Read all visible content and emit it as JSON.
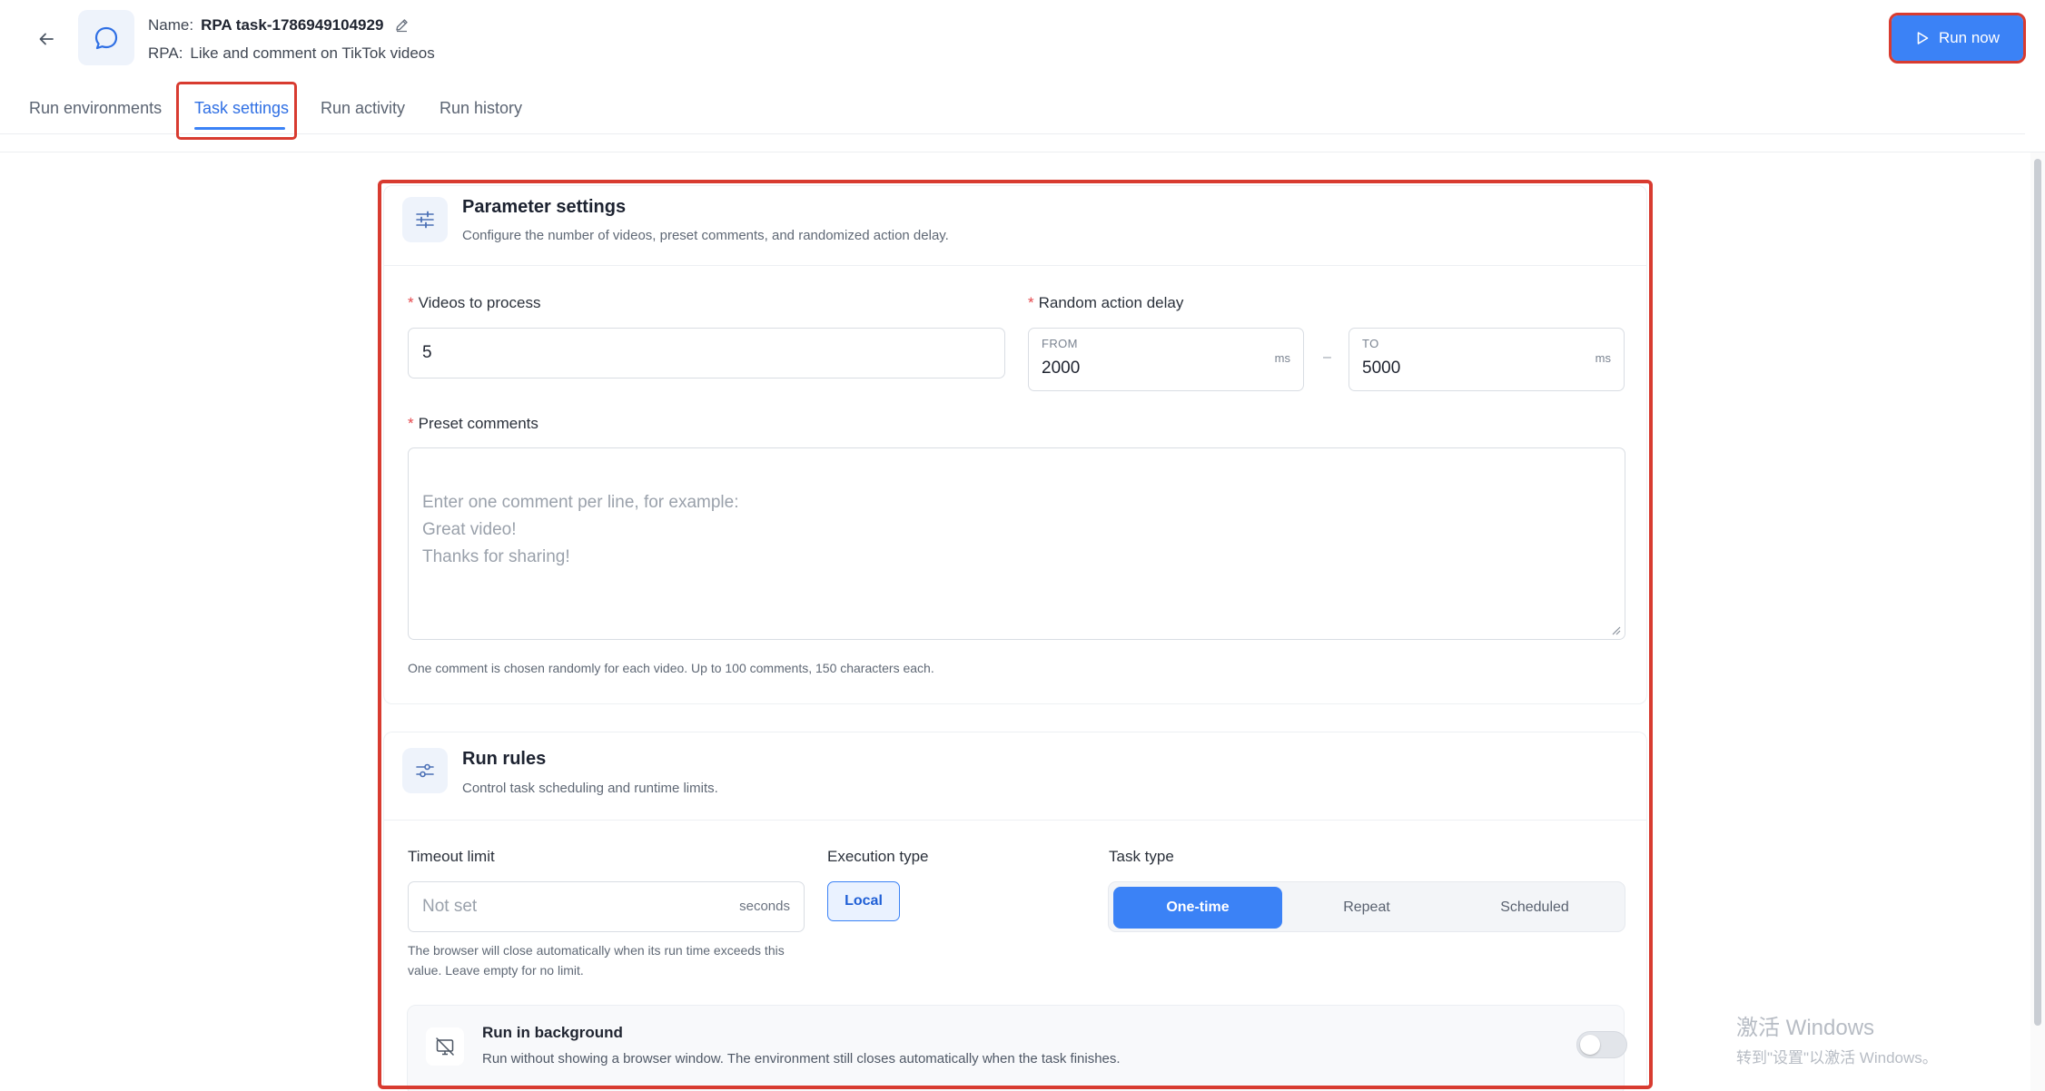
{
  "header": {
    "name_key": "Name:",
    "name_value": "RPA task-1786949104929",
    "rpa_key": "RPA:",
    "rpa_value": "Like and comment on TikTok videos",
    "run_now_label": "Run now"
  },
  "tabs": [
    {
      "label": "Run environments",
      "active": false
    },
    {
      "label": "Task settings",
      "active": true
    },
    {
      "label": "Run activity",
      "active": false
    },
    {
      "label": "Run history",
      "active": false
    }
  ],
  "parameter_settings": {
    "title": "Parameter settings",
    "subtitle": "Configure the number of videos, preset comments, and randomized action delay.",
    "videos_label": "Videos to process",
    "videos_value": "5",
    "delay_label": "Random action delay",
    "delay_from_caption": "FROM",
    "delay_from_value": "2000",
    "delay_to_caption": "TO",
    "delay_to_value": "5000",
    "delay_unit": "ms",
    "delay_separator": "–",
    "comments_label": "Preset comments",
    "comments_placeholder": "Enter one comment per line, for example:\nGreat video!\nThanks for sharing!",
    "comments_help": "One comment is chosen randomly for each video. Up to 100 comments, 150 characters each."
  },
  "run_rules": {
    "title": "Run rules",
    "subtitle": "Control task scheduling and runtime limits.",
    "timeout_label": "Timeout limit",
    "timeout_placeholder": "Not set",
    "timeout_unit": "seconds",
    "timeout_help": "The browser will close automatically when its run time exceeds this value. Leave empty for no limit.",
    "execution_label": "Execution type",
    "execution_value": "Local",
    "task_type_label": "Task type",
    "task_type_options": [
      "One-time",
      "Repeat",
      "Scheduled"
    ],
    "task_type_selected": "One-time",
    "background_title": "Run in background",
    "background_desc": "Run without showing a browser window. The environment still closes automatically when the task finishes.",
    "background_enabled": false
  },
  "watermark": {
    "line1": "激活 Windows",
    "line2": "转到\"设置\"以激活 Windows。"
  },
  "colors": {
    "accent": "#3b82f6",
    "highlight": "#d83b30",
    "required": "#e5484d"
  }
}
